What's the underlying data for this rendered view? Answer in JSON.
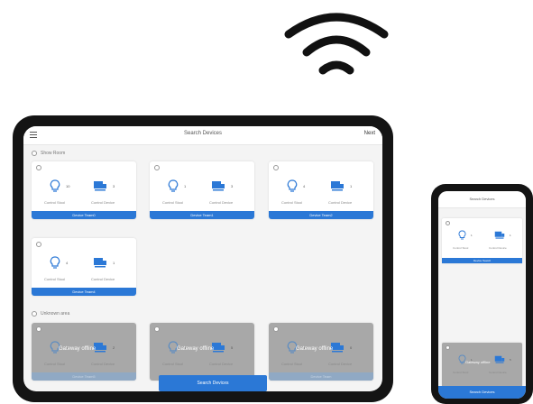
{
  "tablet": {
    "title": "Search Devices",
    "next_label": "Next",
    "menu_icon": "menu-icon",
    "groups": [
      {
        "label": "Show Room"
      },
      {
        "label": "Unknown area"
      }
    ],
    "cards": [
      {
        "bulb_count": "10",
        "device_count": "3",
        "team": "Device Team0",
        "offline": false
      },
      {
        "bulb_count": "1",
        "device_count": "3",
        "team": "Device Team1",
        "offline": false
      },
      {
        "bulb_count": "4",
        "device_count": "1",
        "team": "Device Team2",
        "offline": false
      },
      {
        "bulb_count": "4",
        "device_count": "1",
        "team": "Device Team4",
        "offline": false
      },
      {
        "bulb_count": "1",
        "device_count": "2",
        "team": "Device Team5",
        "offline": true
      },
      {
        "bulb_count": "4",
        "device_count": "5",
        "team": "",
        "offline": true
      },
      {
        "bulb_count": "4",
        "device_count": "0",
        "team": "Device Team",
        "offline": true
      }
    ],
    "labels": {
      "control_stool": "Control Stool",
      "control_device": "Control Device",
      "gateway_offline": "Gateway offline"
    },
    "search_button": "Search Devices"
  },
  "phone": {
    "title": "Search Devices",
    "cards": [
      {
        "bulb_count": "1",
        "device_count": "1",
        "team": "Device Team0",
        "offline": false
      },
      {
        "bulb_count": "1",
        "device_count": "5",
        "team": "",
        "offline": true
      }
    ],
    "search_button": "Search Devices"
  },
  "colors": {
    "accent": "#2b78d6",
    "frame": "#141414",
    "offline_card": "#a8a8a8"
  },
  "icons": [
    "wifi-icon",
    "bulb-icon",
    "device-icon",
    "menu-icon"
  ]
}
